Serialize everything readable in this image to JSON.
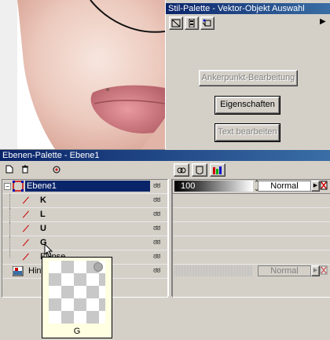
{
  "style_palette": {
    "title": "Stil-Palette - Vektor-Objekt Auswahl",
    "buttons": {
      "anchor_edit": "Ankerpunkt-Bearbeitung",
      "properties": "Eigenschaften",
      "edit_text": "Text bearbeiten"
    }
  },
  "layer_palette": {
    "title": "Ebenen-Palette - Ebene1",
    "layers": [
      {
        "name": "Ebene1"
      },
      {
        "name": "K"
      },
      {
        "name": "L"
      },
      {
        "name": "U"
      },
      {
        "name": "G"
      },
      {
        "name": "Ellipse"
      },
      {
        "name": "Hintergrund"
      }
    ],
    "opacity": "100",
    "blend_mode": "Normal",
    "blend_mode_bg": "Normal",
    "tooltip_label": "G"
  }
}
